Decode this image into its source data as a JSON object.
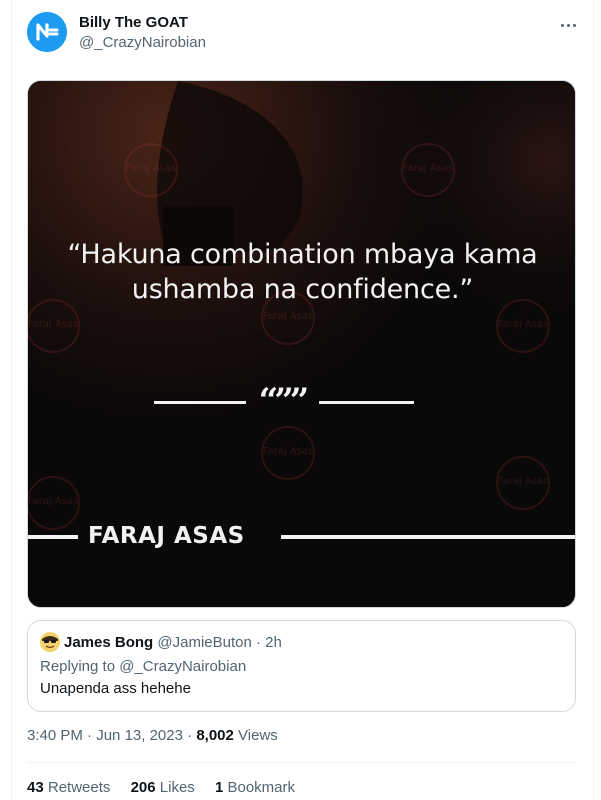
{
  "author": {
    "display_name": "Billy The GOAT",
    "handle": "@_CrazyNairobian",
    "avatar_icon": "brand-logo-icon"
  },
  "more_icon": "more-horizontal-icon",
  "media": {
    "quote": "“Hakuna combination mbaya kama ushamba na confidence.”",
    "quote_mark": "“””",
    "author_name": "FARAJ ASAS",
    "watermark_text": "Faraj Asas"
  },
  "quoted_tweet": {
    "name": "James Bong",
    "handle": "@JamieButon",
    "separator": "·",
    "time": "2h",
    "replying_prefix": "Replying to",
    "replying_handle": "@_CrazyNairobian",
    "text": "Unapenda ass hehehe",
    "avatar_icon": "emoji-avatar-icon"
  },
  "meta": {
    "time": "3:40 PM",
    "sep1": "·",
    "date": "Jun 13, 2023",
    "sep2": "·",
    "views_count": "8,002",
    "views_label": "Views"
  },
  "stats": {
    "retweets_count": "43",
    "retweets_label": "Retweets",
    "likes_count": "206",
    "likes_label": "Likes",
    "bookmarks_count": "1",
    "bookmarks_label": "Bookmark"
  },
  "colors": {
    "accent": "#1d9bf0",
    "secondary_text": "#536471",
    "primary_text": "#0f1419"
  }
}
